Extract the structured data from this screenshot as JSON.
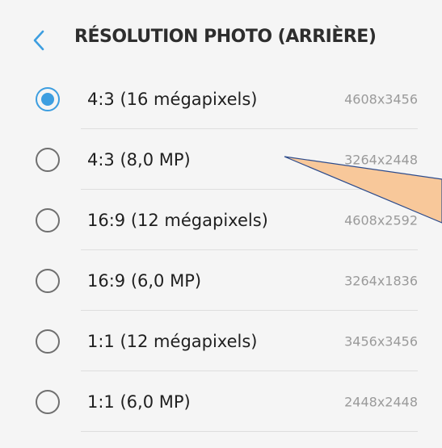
{
  "header": {
    "title": "RÉSOLUTION PHOTO (ARRIÈRE)",
    "back_icon": "chevron-left-icon"
  },
  "colors": {
    "accent": "#3d9ee0",
    "background": "#f5f5f5",
    "annotation_fill": "#f8c89a",
    "annotation_stroke": "#2c4b8c"
  },
  "options": [
    {
      "label": "4:3 (16 mégapixels)",
      "size": "4608x3456",
      "selected": true
    },
    {
      "label": "4:3 (8,0 MP)",
      "size": "3264x2448",
      "selected": false
    },
    {
      "label": "16:9 (12 mégapixels)",
      "size": "4608x2592",
      "selected": false
    },
    {
      "label": "16:9 (6,0 MP)",
      "size": "3264x1836",
      "selected": false
    },
    {
      "label": "1:1 (12 mégapixels)",
      "size": "3456x3456",
      "selected": false
    },
    {
      "label": "1:1 (6,0 MP)",
      "size": "2448x2448",
      "selected": false
    }
  ]
}
